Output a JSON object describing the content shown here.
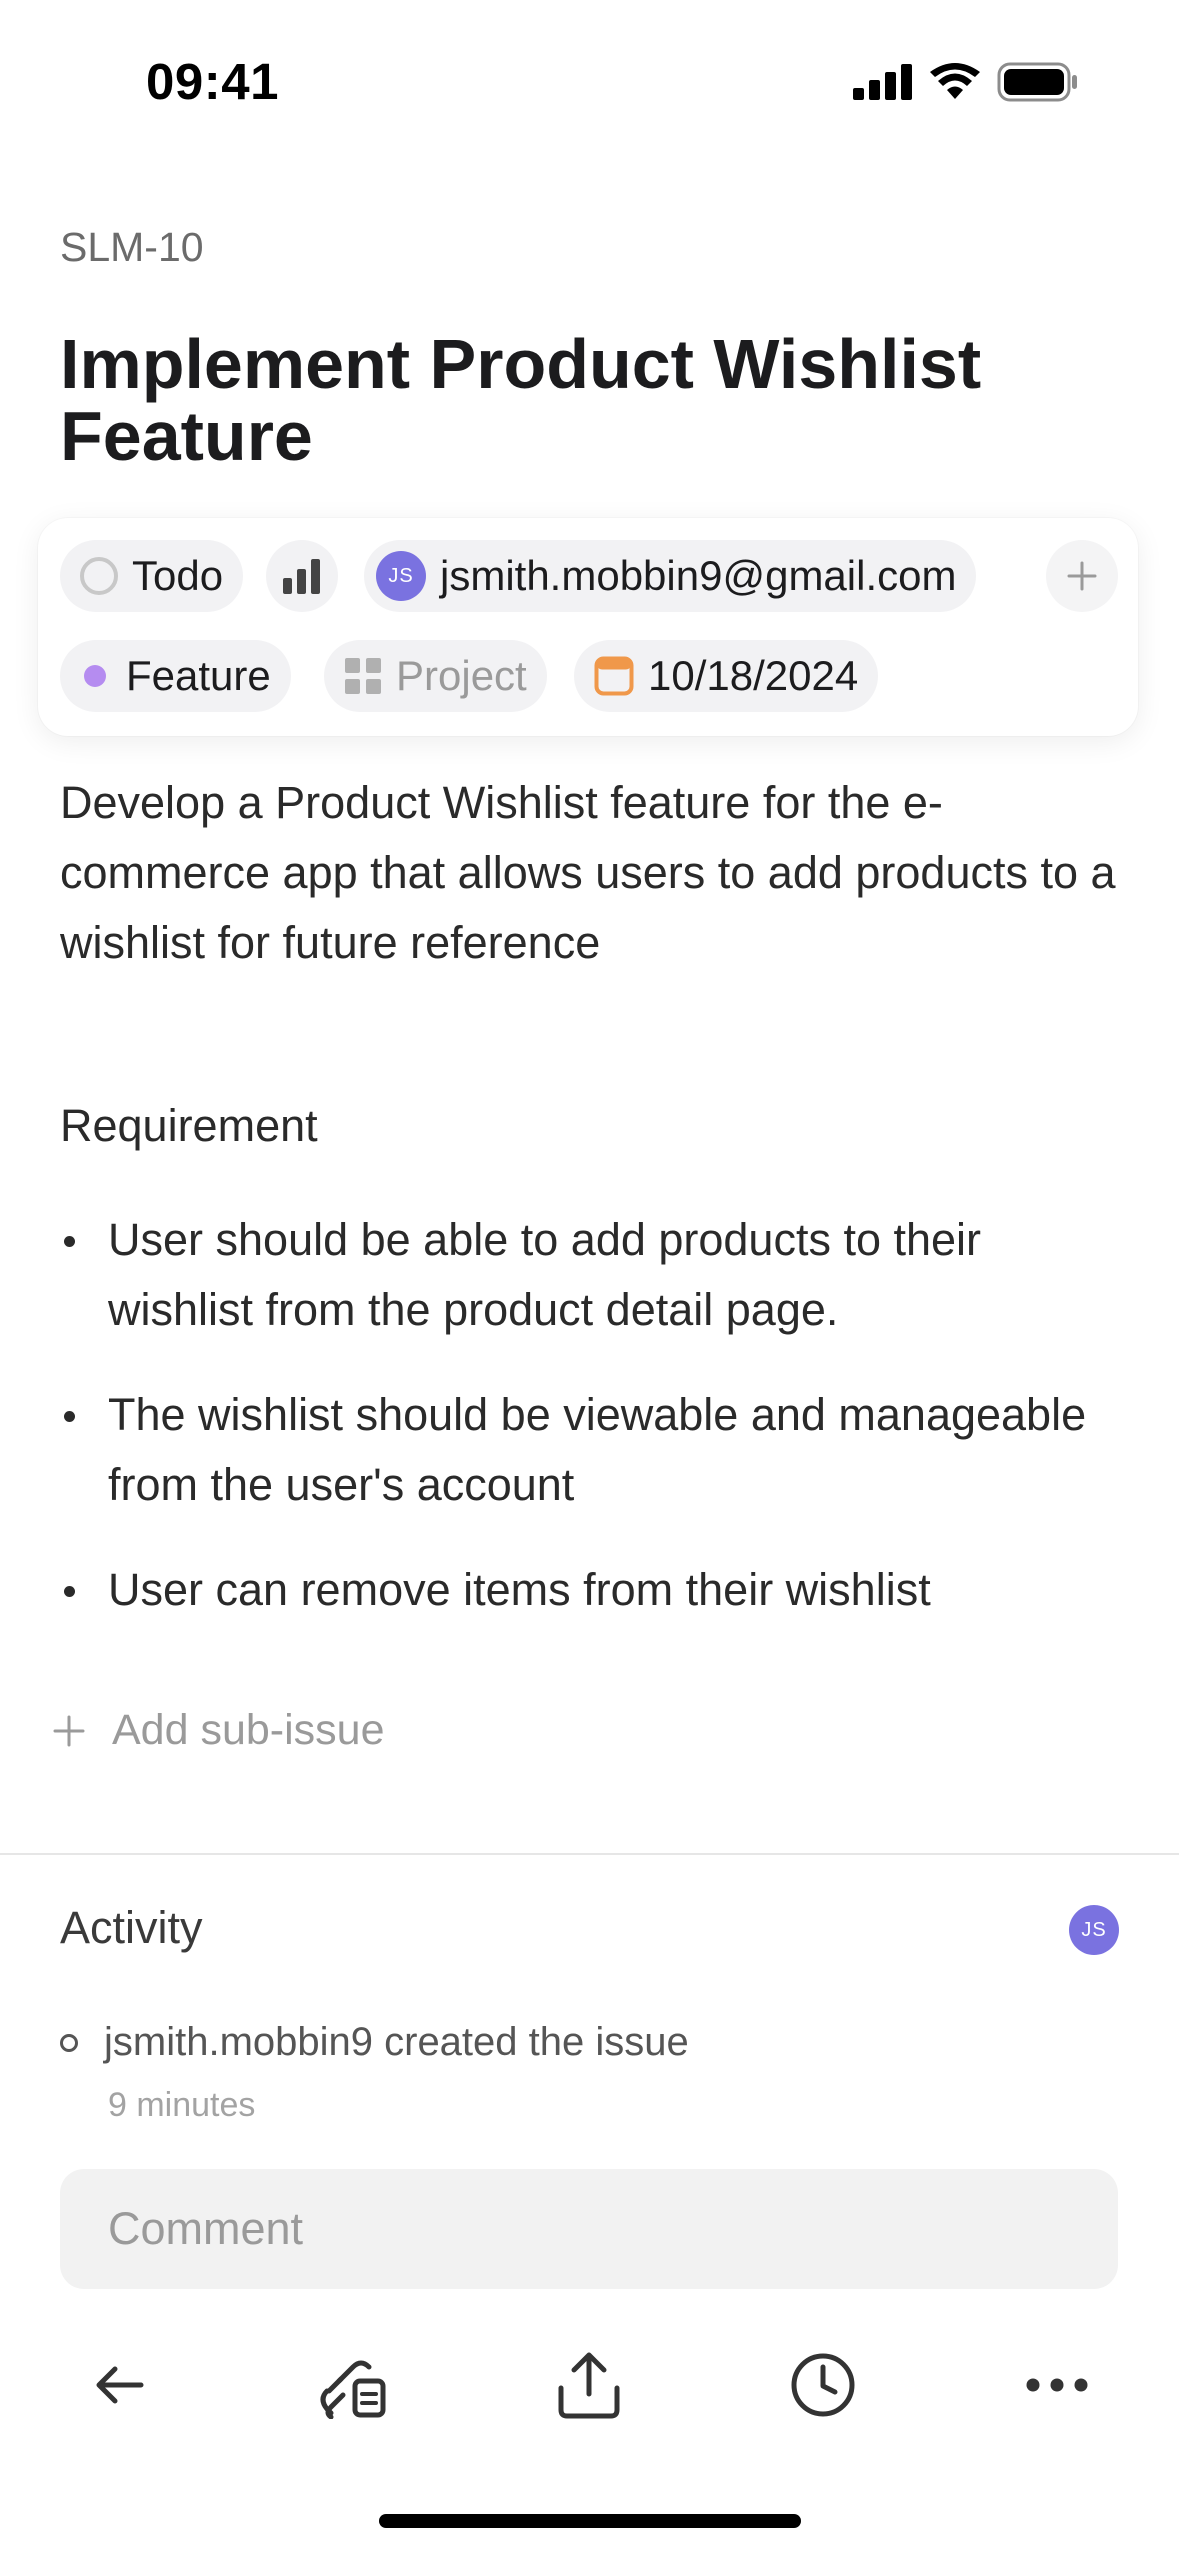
{
  "status_bar": {
    "time": "09:41"
  },
  "issue": {
    "id": "SLM-10",
    "title": "Implement Product Wishlist Feature",
    "properties": {
      "status": "Todo",
      "priority_icon": "bar-chart-icon",
      "assignee_initials": "JS",
      "assignee": "jsmith.mobbin9@gmail.com",
      "label": "Feature",
      "label_color": "#b58cf0",
      "project": "Project",
      "due_date": "10/18/2024",
      "date_color": "#f0984a"
    },
    "description": "Develop a Product Wishlist feature for the e-commerce app that allows users to add products to a wishlist for future reference",
    "requirement_heading": "Requirement",
    "requirements": [
      "User should be able to add products to their wishlist from the product detail page.",
      "The wishlist should be viewable and manageable from the user's account",
      "User can remove items from their wishlist"
    ],
    "add_sub_issue": "Add sub-issue"
  },
  "activity": {
    "title": "Activity",
    "avatar_initials": "JS",
    "items": [
      {
        "text": "jsmith.mobbin9 created the issue",
        "time": "9 minutes"
      }
    ]
  },
  "comment": {
    "placeholder": "Comment"
  },
  "toolbar": {
    "icons": [
      "back-arrow-icon",
      "copy-link-icon",
      "share-icon",
      "history-icon",
      "more-icon"
    ]
  },
  "colors": {
    "avatar": "#7a72e0",
    "text": "#1c1c1e",
    "muted": "#9a9a9a"
  }
}
